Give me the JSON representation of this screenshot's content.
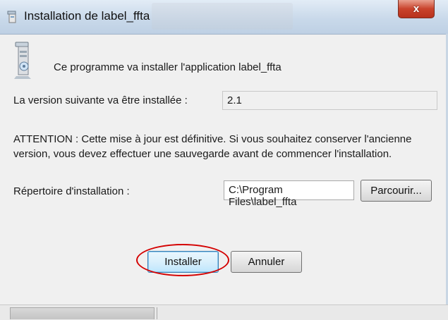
{
  "window": {
    "title": "Installation de label_ffta",
    "close_glyph": "x"
  },
  "icons": {
    "title_icon": "installer-icon",
    "app_icon": "setup-computer-icon"
  },
  "intro_text": "Ce programme va installer l'application label_ffta",
  "version": {
    "label": "La version suivante va être installée :",
    "value": "2.1"
  },
  "warning_text": "ATTENTION : Cette mise à jour est définitive. Si vous souhaitez conserver l'ancienne version, vous devez effectuer une sauvegarde avant de commencer l'installation.",
  "install_dir": {
    "label": "Répertoire d'installation :",
    "value": "C:\\Program Files\\label_ffta",
    "browse_label": "Parcourir..."
  },
  "buttons": {
    "install_label": "Installer",
    "cancel_label": "Annuler"
  },
  "colors": {
    "highlight_ellipse": "#d40000",
    "close_button": "#c9432c",
    "titlebar": "#c9d9ea"
  }
}
